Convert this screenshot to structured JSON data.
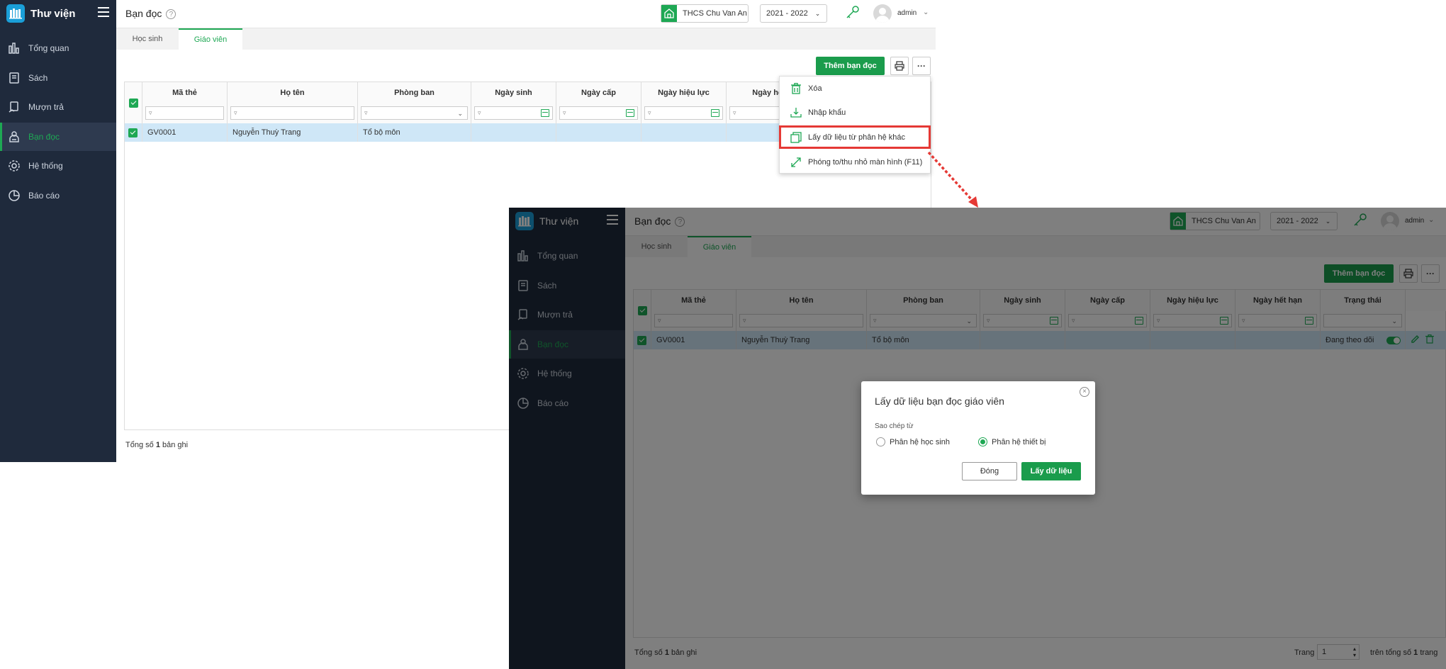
{
  "app": {
    "name": "Thư viện"
  },
  "nav": [
    {
      "label": "Tổng quan",
      "icon": "bar-chart-icon"
    },
    {
      "label": "Sách",
      "icon": "book-icon"
    },
    {
      "label": "Mượn trả",
      "icon": "borrow-icon"
    },
    {
      "label": "Bạn đọc",
      "icon": "reader-icon",
      "active": true
    },
    {
      "label": "Hệ thống",
      "icon": "gear-icon"
    },
    {
      "label": "Báo cáo",
      "icon": "pie-chart-icon"
    }
  ],
  "header": {
    "title": "Bạn đọc",
    "help": "?",
    "school": "THCS Chu Van An",
    "year": "2021 - 2022",
    "user": "admin"
  },
  "tabs": [
    {
      "label": "Học sinh"
    },
    {
      "label": "Giáo viên",
      "active": true
    }
  ],
  "toolbar": {
    "add_label": "Thêm bạn đọc",
    "more_label": "···"
  },
  "columns": [
    "Mã thẻ",
    "Họ tên",
    "Phòng ban",
    "Ngày sinh",
    "Ngày cấp",
    "Ngày hiệu lực",
    "Ngày hết hạn",
    "Trạng thái"
  ],
  "screen1_cut_column": "Ngày hết",
  "row": {
    "ma_the": "GV0001",
    "ho_ten": "Nguyễn Thuỳ Trang",
    "phong_ban": "Tổ bộ môn",
    "trang_thai": "Đang theo dõi"
  },
  "footer": {
    "prefix": "Tổng số",
    "count": "1",
    "suffix": "bản ghi"
  },
  "pager": {
    "label": "Trang",
    "value": "1",
    "total_text_prefix": "trên tổng số",
    "total": "1",
    "total_text_suffix": "trang"
  },
  "menu": [
    {
      "label": "Xóa",
      "icon": "trash-icon"
    },
    {
      "label": "Nhập khẩu",
      "icon": "import-icon"
    },
    {
      "label": "Lấy dữ liệu từ phân hệ khác",
      "icon": "copy-icon",
      "highlight": true
    },
    {
      "label": "Phóng to/thu nhỏ màn hình (F11)",
      "icon": "expand-icon"
    }
  ],
  "dialog": {
    "title": "Lấy dữ liệu bạn đọc giáo viên",
    "copy_from_label": "Sao chép từ",
    "options": [
      {
        "label": "Phân hệ học sinh",
        "selected": false
      },
      {
        "label": "Phân hệ thiết bị",
        "selected": true
      }
    ],
    "close_label": "Đóng",
    "submit_label": "Lấy dữ liệu"
  },
  "colors": {
    "brand": "#1a9c4c",
    "sidebar": "#1f2a3c",
    "highlight": "#e53935",
    "row_selected": "#cfe7f7"
  }
}
